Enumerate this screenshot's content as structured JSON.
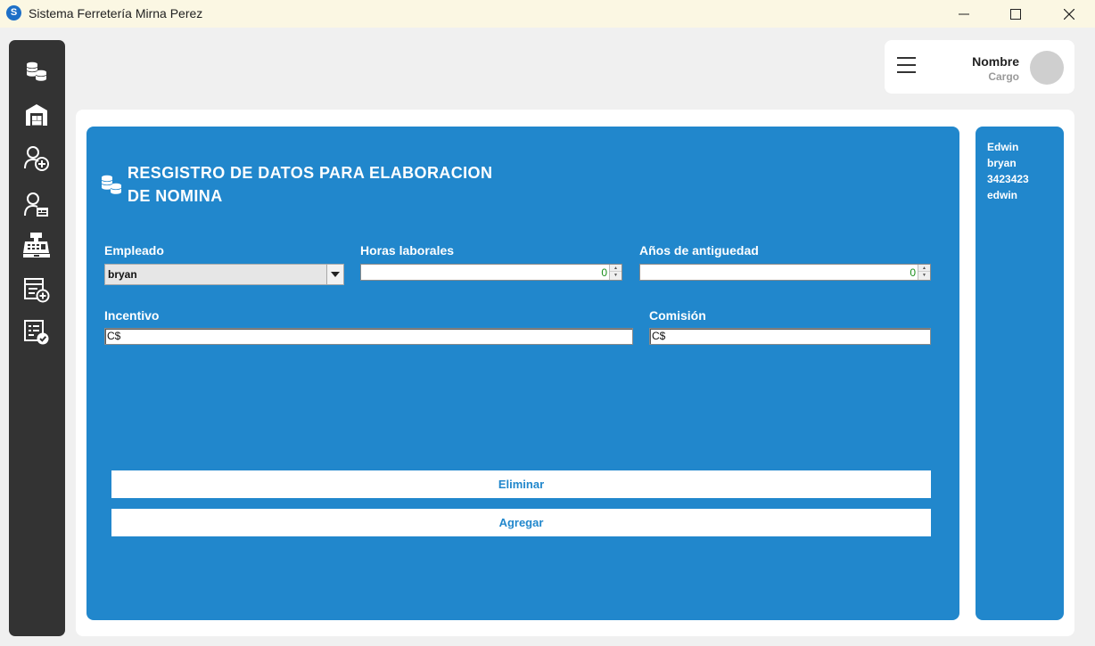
{
  "window": {
    "title": "Sistema Ferretería Mirna Perez",
    "app_icon_letter": "S"
  },
  "sidebar": {
    "items": [
      {
        "icon": "coins-icon"
      },
      {
        "icon": "warehouse-icon"
      },
      {
        "icon": "add-user-icon"
      },
      {
        "icon": "user-badge-icon"
      },
      {
        "icon": "cash-register-icon"
      },
      {
        "icon": "add-invoice-icon"
      },
      {
        "icon": "approved-invoice-icon"
      }
    ]
  },
  "header": {
    "user_name": "Nombre",
    "user_role": "Cargo"
  },
  "form": {
    "title_line1": "RESGISTRO DE DATOS PARA ELABORACION",
    "title_line2": "DE NOMINA",
    "empleado_label": "Empleado",
    "empleado_value": "bryan",
    "horas_label": "Horas laborales",
    "horas_value": "0",
    "antiguedad_label": "Años de antiguedad",
    "antiguedad_value": "0",
    "incentivo_label": "Incentivo",
    "incentivo_value": "C$",
    "comision_label": "Comisión",
    "comision_value": "C$",
    "eliminar_label": "Eliminar",
    "agregar_label": "Agregar"
  },
  "side_list": [
    "Edwin",
    "bryan",
    "3423423",
    "edwin"
  ],
  "colors": {
    "accent": "#2187cc",
    "sidebar": "#333333",
    "titlebar": "#fbf7e3"
  }
}
